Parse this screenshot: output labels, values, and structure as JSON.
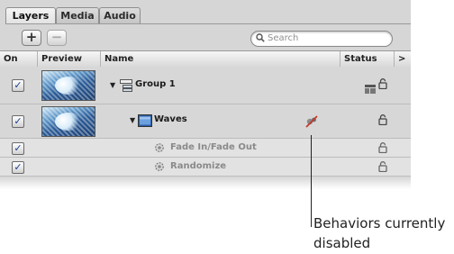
{
  "tabs": [
    {
      "label": "Layers",
      "active": true
    },
    {
      "label": "Media",
      "active": false
    },
    {
      "label": "Audio",
      "active": false
    }
  ],
  "toolbar": {
    "add_label": "+",
    "remove_label": "−",
    "search_placeholder": "Search"
  },
  "columns": {
    "on": "On",
    "preview": "Preview",
    "name": "Name",
    "status": "Status",
    "overflow": ">"
  },
  "rows": [
    {
      "name": "Group 1",
      "type": "group",
      "checked": true,
      "icons": [
        "group-icon",
        "lock-icon"
      ]
    },
    {
      "name": "Waves",
      "type": "layer",
      "checked": true,
      "icons": [
        "layer-icon",
        "behaviors-disabled-icon",
        "lock-icon"
      ]
    },
    {
      "name": "Fade In/Fade Out",
      "type": "behavior",
      "checked": true,
      "icons": [
        "behavior-gear-icon",
        "lock-icon"
      ]
    },
    {
      "name": "Randomize",
      "type": "behavior",
      "checked": true,
      "icons": [
        "behavior-gear-icon",
        "lock-icon"
      ]
    }
  ],
  "glyphs": {
    "check": "✓",
    "disclosure": "▼",
    "lock": "🔓",
    "gear": "⚙",
    "search": "🔍"
  },
  "callout": {
    "text": "Behaviors currently disabled"
  },
  "colors": {
    "panel": "#d6d6d6",
    "check": "#1c3f8f",
    "accent_blue": "#2a5a96"
  }
}
